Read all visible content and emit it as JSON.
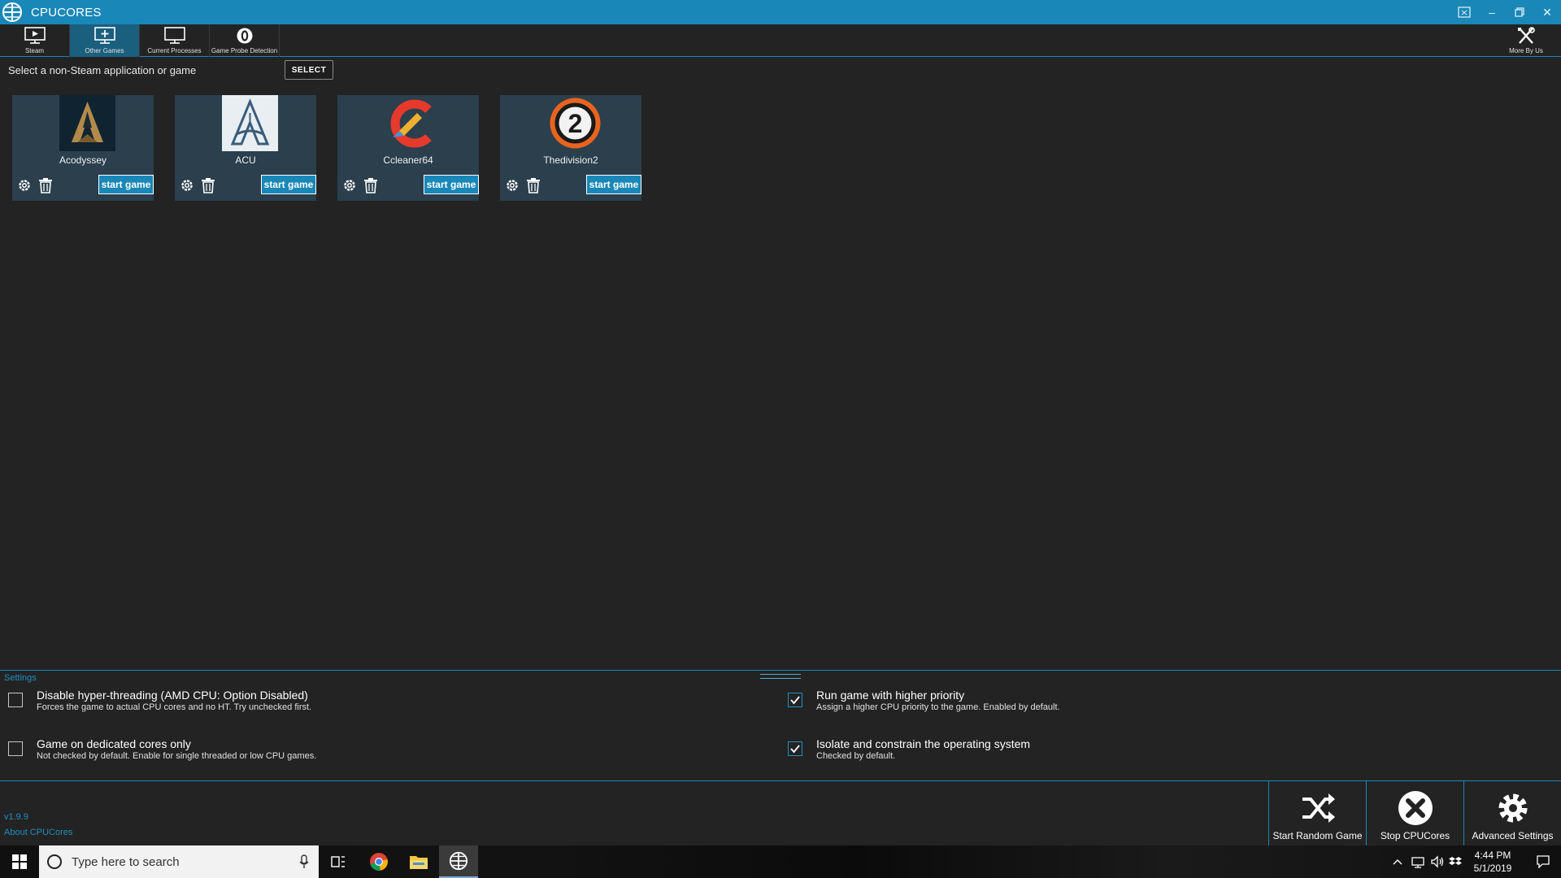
{
  "app": {
    "title": "CPUCORES",
    "accent": "#1987b8",
    "background": "#232323",
    "card_background": "#2b3f4d"
  },
  "toolbar": {
    "tabs": [
      {
        "label": "Steam",
        "icon": "monitor-play-icon",
        "active": false
      },
      {
        "label": "Other Games",
        "icon": "monitor-plus-icon",
        "active": true
      },
      {
        "label": "Current Processes",
        "icon": "monitor-icon",
        "active": false
      },
      {
        "label": "Game Probe Detection",
        "icon": "probe-zero-icon",
        "active": false
      }
    ],
    "more": {
      "label": "More By Us",
      "icon": "tools-icon"
    }
  },
  "select": {
    "prompt": "Select a non-Steam application or game",
    "button_label": "SELECT"
  },
  "games": [
    {
      "name": "Acodyssey",
      "icon": "acodyssey-game-icon",
      "start_label": "start game"
    },
    {
      "name": "ACU",
      "icon": "acu-game-icon",
      "start_label": "start game"
    },
    {
      "name": "Ccleaner64",
      "icon": "ccleaner-game-icon",
      "start_label": "start game"
    },
    {
      "name": "Thedivision2",
      "icon": "division2-game-icon",
      "start_label": "start game"
    }
  ],
  "settings": {
    "label": "Settings",
    "options": [
      {
        "title": "Disable hyper-threading (AMD CPU: Option Disabled)",
        "desc": "Forces the game to actual CPU cores and no HT. Try unchecked first.",
        "checked": false
      },
      {
        "title": "Game on dedicated cores only",
        "desc": "Not checked by default. Enable for single threaded or low CPU games.",
        "checked": false
      },
      {
        "title": "Run game with higher priority",
        "desc": "Assign a higher CPU priority to the game. Enabled by default.",
        "checked": true
      },
      {
        "title": "Isolate and constrain the operating system",
        "desc": "Checked by default.",
        "checked": true
      }
    ]
  },
  "footer": {
    "version": "v1.9.9",
    "about": "About CPUCores",
    "actions": [
      {
        "label": "Start Random Game",
        "icon": "shuffle-icon"
      },
      {
        "label": "Stop CPUCores",
        "icon": "stop-x-icon"
      },
      {
        "label": "Advanced Settings",
        "icon": "gear-icon"
      }
    ]
  },
  "taskbar": {
    "search_placeholder": "Type here to search",
    "time": "4:44 PM",
    "date": "5/1/2019"
  }
}
